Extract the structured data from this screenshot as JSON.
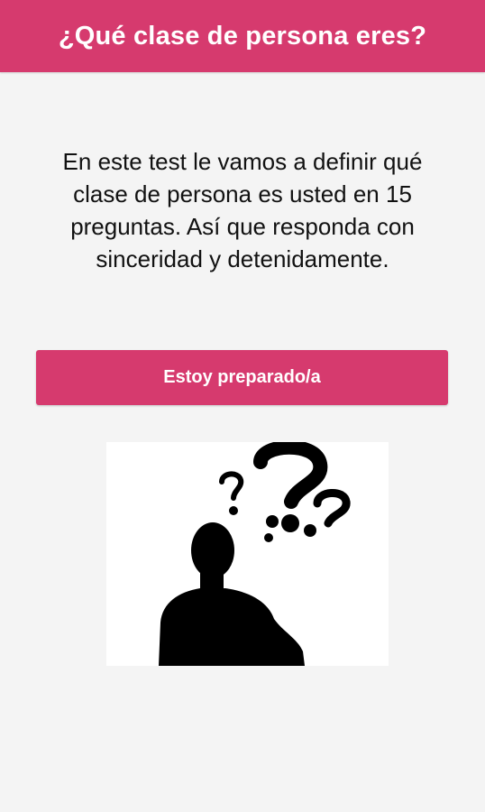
{
  "header": {
    "title": "¿Qué clase de persona eres?",
    "background_color": "#d63a6e"
  },
  "intro": {
    "lines": [
      "En este test le vamos a definir qué",
      "clase de persona es usted en 15",
      "preguntas. Así que responda con",
      "sinceridad y detenidamente."
    ]
  },
  "start_button": {
    "label": "Estoy preparado/a",
    "color": "#d63a6e"
  },
  "illustration": {
    "icon": "person-with-question-marks-icon"
  }
}
